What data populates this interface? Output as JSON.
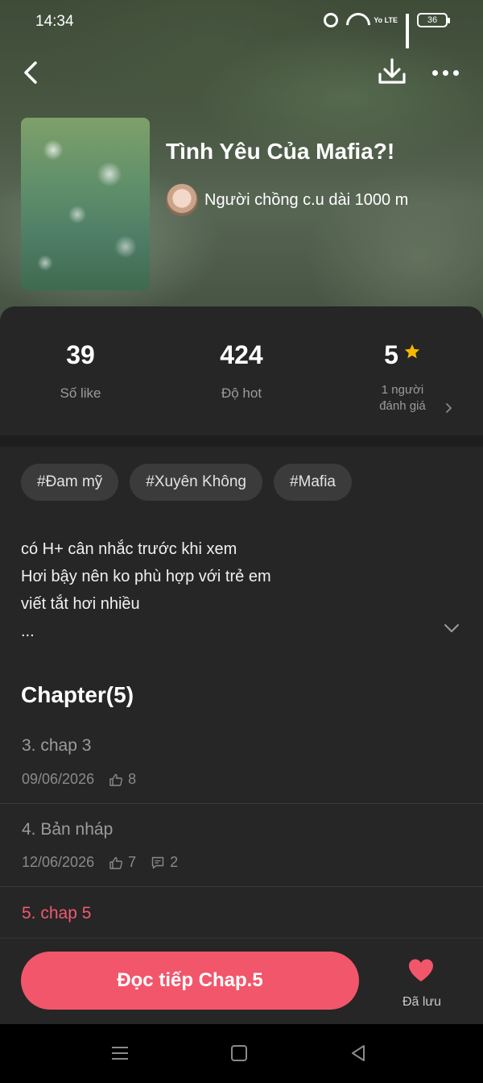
{
  "status_bar": {
    "time": "14:34",
    "battery": "36",
    "network_label": "Yo LTE"
  },
  "book": {
    "title": "Tình Yêu Của Mafia?!",
    "author": "Người chồng c.u dài 1000 m"
  },
  "stats": {
    "likes_value": "39",
    "likes_label": "Số like",
    "hot_value": "424",
    "hot_label": "Độ hot",
    "rating_value": "5",
    "rating_label_line1": "1 người",
    "rating_label_line2": "đánh giá"
  },
  "tags": [
    "#Đam mỹ",
    "#Xuyên Không",
    "#Mafia"
  ],
  "description": {
    "line1": "có H+ cân nhắc trước khi xem",
    "line2": "Hơi bậy nên ko phù hợp với trẻ em",
    "line3": "viết tắt hơi nhiều",
    "line4": "..."
  },
  "chapters": {
    "heading": "Chapter(5)",
    "items": [
      {
        "title": "3. chap 3",
        "date": "09/06/2026",
        "likes": "8"
      },
      {
        "title": "4. Bản nháp",
        "date": "12/06/2026",
        "likes": "7",
        "comments": "2"
      },
      {
        "title": "5. chap 5"
      }
    ]
  },
  "actions": {
    "read_button": "Đọc tiếp Chap.5",
    "saved_label": "Đã lưu"
  },
  "colors": {
    "accent": "#f2566b",
    "star": "#f5b800",
    "sheet_bg": "#262626"
  }
}
